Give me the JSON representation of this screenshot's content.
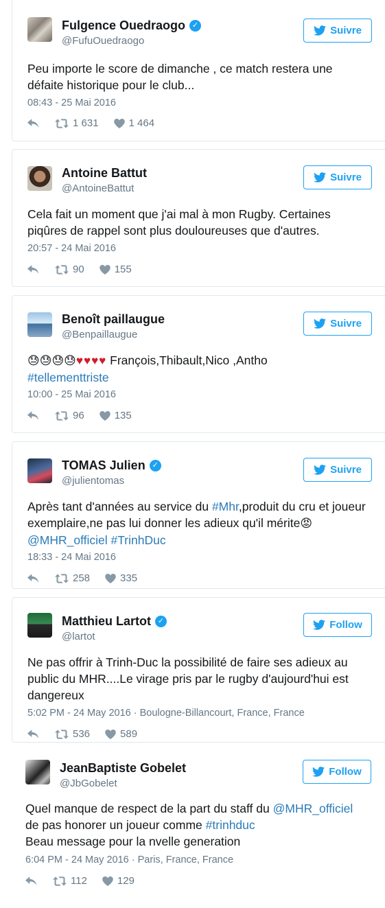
{
  "tweets": [
    {
      "name": "Fulgence Ouedraogo",
      "verified": true,
      "handle": "@FufuOuedraogo",
      "follow_label": "Suivre",
      "text": "Peu importe le score de dimanche , ce match restera une défaite historique pour le club...",
      "time": "08:43 - 25 Mai 2016",
      "retweets": "1 631",
      "likes": "1 464"
    },
    {
      "name": "Antoine Battut",
      "verified": false,
      "handle": "@AntoineBattut",
      "follow_label": "Suivre",
      "text": "Cela fait un moment que j'ai mal à mon Rugby. Certaines piqûres de rappel sont plus douloureuses que d'autres.",
      "time": "20:57 - 24 Mai 2016",
      "retweets": "90",
      "likes": "155"
    },
    {
      "name": "Benoît paillaugue",
      "verified": false,
      "handle": "@Benpaillaugue",
      "follow_label": "Suivre",
      "text_plain": "François,Thibault,Nico ,Antho",
      "hashtag": "#tellementtriste",
      "emoji_sad": "😓😓😓😓",
      "emoji_hearts": "♥♥♥♥",
      "time": "10:00 - 25 Mai 2016",
      "retweets": "96",
      "likes": "135"
    },
    {
      "name": "TOMAS Julien",
      "verified": true,
      "handle": "@julientomas",
      "follow_label": "Suivre",
      "text_a": "Après tant d'années au service du ",
      "link_a": "#Mhr",
      "text_b": ",produit du cru et joueur exemplaire,ne pas lui donner les adieux qu'il mérite",
      "emoji_angry": "😡",
      "link_b": "@MHR_officiel",
      "link_c": "#TrinhDuc",
      "time": "18:33 - 24 Mai 2016",
      "retweets": "258",
      "likes": "335"
    },
    {
      "name": "Matthieu Lartot",
      "verified": true,
      "handle": "@lartot",
      "follow_label": "Follow",
      "text": "Ne pas offrir à Trinh-Duc la possibilité de faire ses adieux au public du MHR....Le virage pris par le rugby d'aujourd'hui est dangereux",
      "time": "5:02 PM - 24 May 2016 · Boulogne-Billancourt, France, France",
      "retweets": "536",
      "likes": "589"
    },
    {
      "name": "JeanBaptiste Gobelet",
      "verified": false,
      "handle": "@JbGobelet",
      "follow_label": "Follow",
      "text_a": "Quel manque de respect de la part du staff du ",
      "link_a": "@MHR_officiel",
      "text_b": " de pas honorer un joueur comme ",
      "link_b": "#trinhduc",
      "text_c": "Beau message pour la nvelle generation",
      "time": "6:04 PM - 24 May 2016 · Paris, France, France",
      "retweets": "112",
      "likes": "129"
    }
  ],
  "colors": {
    "accent": "#1da1f2",
    "link": "#2b7bb9",
    "muted": "#657786"
  },
  "icons": {
    "reply": "reply-icon",
    "retweet": "retweet-icon",
    "like": "heart-icon",
    "bird": "twitter-bird-icon",
    "verified": "verified-badge-icon"
  }
}
